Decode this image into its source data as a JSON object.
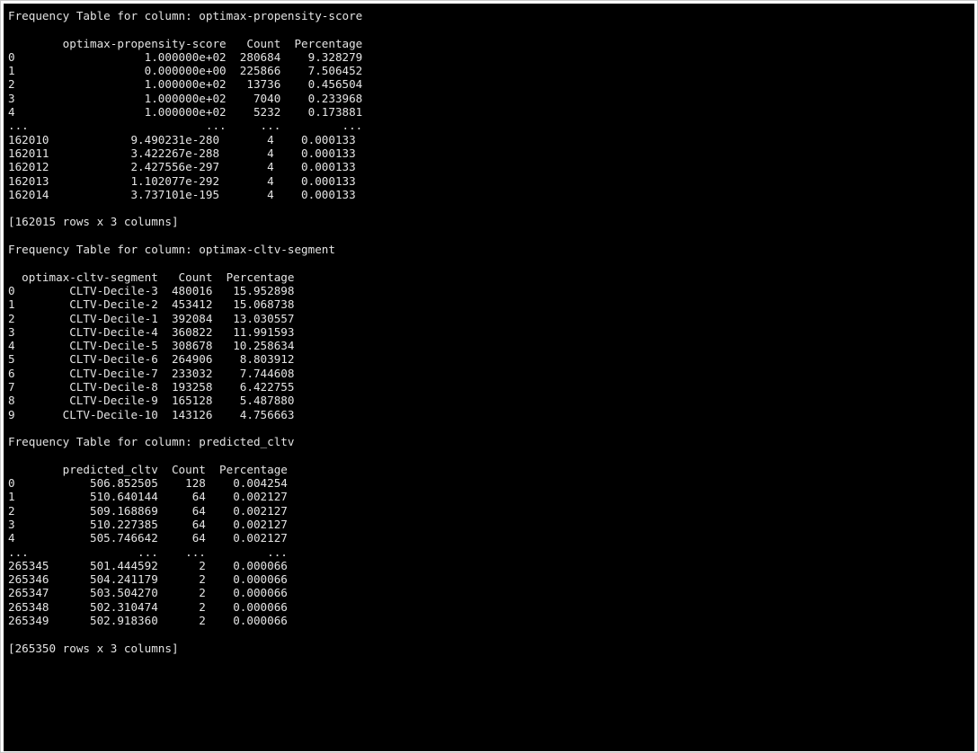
{
  "output": {
    "lines": [
      "Frequency Table for column: optimax-propensity-score",
      "",
      "        optimax-propensity-score   Count  Percentage",
      "0                   1.000000e+02  280684    9.328279",
      "1                   0.000000e+00  225866    7.506452",
      "2                   1.000000e+02   13736    0.456504",
      "3                   1.000000e+02    7040    0.233968",
      "4                   1.000000e+02    5232    0.173881",
      "...                          ...     ...         ...",
      "162010            9.490231e-280       4    0.000133",
      "162011            3.422267e-288       4    0.000133",
      "162012            2.427556e-297       4    0.000133",
      "162013            1.102077e-292       4    0.000133",
      "162014            3.737101e-195       4    0.000133",
      "",
      "[162015 rows x 3 columns]",
      "",
      "Frequency Table for column: optimax-cltv-segment",
      "",
      "  optimax-cltv-segment   Count  Percentage",
      "0        CLTV-Decile-3  480016   15.952898",
      "1        CLTV-Decile-2  453412   15.068738",
      "2        CLTV-Decile-1  392084   13.030557",
      "3        CLTV-Decile-4  360822   11.991593",
      "4        CLTV-Decile-5  308678   10.258634",
      "5        CLTV-Decile-6  264906    8.803912",
      "6        CLTV-Decile-7  233032    7.744608",
      "7        CLTV-Decile-8  193258    6.422755",
      "8        CLTV-Decile-9  165128    5.487880",
      "9       CLTV-Decile-10  143126    4.756663",
      "",
      "Frequency Table for column: predicted_cltv",
      "",
      "        predicted_cltv  Count  Percentage",
      "0           506.852505    128    0.004254",
      "1           510.640144     64    0.002127",
      "2           509.168869     64    0.002127",
      "3           510.227385     64    0.002127",
      "4           505.746642     64    0.002127",
      "...                ...    ...         ...",
      "265345      501.444592      2    0.000066",
      "265346      504.241179      2    0.000066",
      "265347      503.504270      2    0.000066",
      "265348      502.310474      2    0.000066",
      "265349      502.918360      2    0.000066",
      "",
      "[265350 rows x 3 columns]"
    ]
  }
}
